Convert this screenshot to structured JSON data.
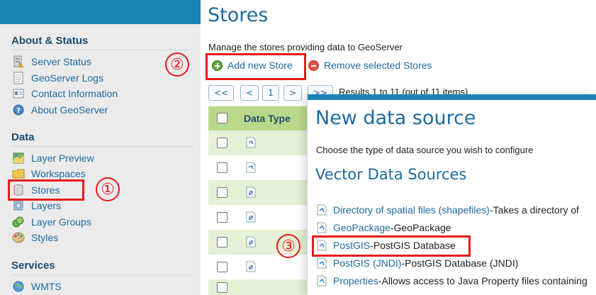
{
  "sidebar": {
    "sections": {
      "about": {
        "title": "About & Status"
      },
      "data": {
        "title": "Data"
      },
      "services": {
        "title": "Services"
      }
    },
    "about_items": [
      {
        "label": "Server Status",
        "icon": "server-status-icon"
      },
      {
        "label": "GeoServer Logs",
        "icon": "logs-icon"
      },
      {
        "label": "Contact Information",
        "icon": "contact-card-icon"
      },
      {
        "label": "About GeoServer",
        "icon": "help-circle-icon"
      }
    ],
    "data_items": [
      {
        "label": "Layer Preview",
        "icon": "layer-preview-icon"
      },
      {
        "label": "Workspaces",
        "icon": "folder-icon"
      },
      {
        "label": "Stores",
        "icon": "database-cylinder-icon"
      },
      {
        "label": "Layers",
        "icon": "layers-icon"
      },
      {
        "label": "Layer Groups",
        "icon": "layer-groups-icon"
      },
      {
        "label": "Styles",
        "icon": "palette-icon"
      }
    ],
    "services_items": [
      {
        "label": "WMTS",
        "icon": "globe-icon"
      }
    ]
  },
  "main": {
    "title": "Stores",
    "description": "Manage the stores providing data to GeoServer",
    "actions": {
      "add": "Add new Store",
      "remove": "Remove selected Stores"
    },
    "pager": {
      "first": "<<",
      "prev": "<",
      "current": "1",
      "next": ">",
      "last": ">>",
      "results": "Results 1 to 11 (out of 11 items)"
    },
    "table": {
      "column_type": "Data Type",
      "row_icons": [
        "vector-store-icon",
        "vector-store-icon",
        "raster-store-icon",
        "raster-store-icon",
        "raster-store-icon",
        "raster-store-icon"
      ]
    }
  },
  "popup": {
    "title": "New data source",
    "description": "Choose the type of data source you wish to configure",
    "section": "Vector Data Sources",
    "sources": [
      {
        "name": "Directory of spatial files (shapefiles)",
        "desc": "Takes a directory of"
      },
      {
        "name": "GeoPackage",
        "desc": "GeoPackage"
      },
      {
        "name": "PostGIS",
        "desc": "PostGIS Database"
      },
      {
        "name": "PostGIS (JNDI)",
        "desc": "PostGIS Database (JNDI)"
      },
      {
        "name": "Properties",
        "desc": "Allows access to Java Property files containing"
      }
    ],
    "separator": " - "
  },
  "annotations": {
    "step1": "①",
    "step2": "②",
    "step3": "③",
    "color": "#e61b1b"
  },
  "colors": {
    "accent": "#1a84b6",
    "link": "#1e6aa0",
    "table_header": "#b9d88b",
    "table_alt_row": "#e6f0d6"
  }
}
